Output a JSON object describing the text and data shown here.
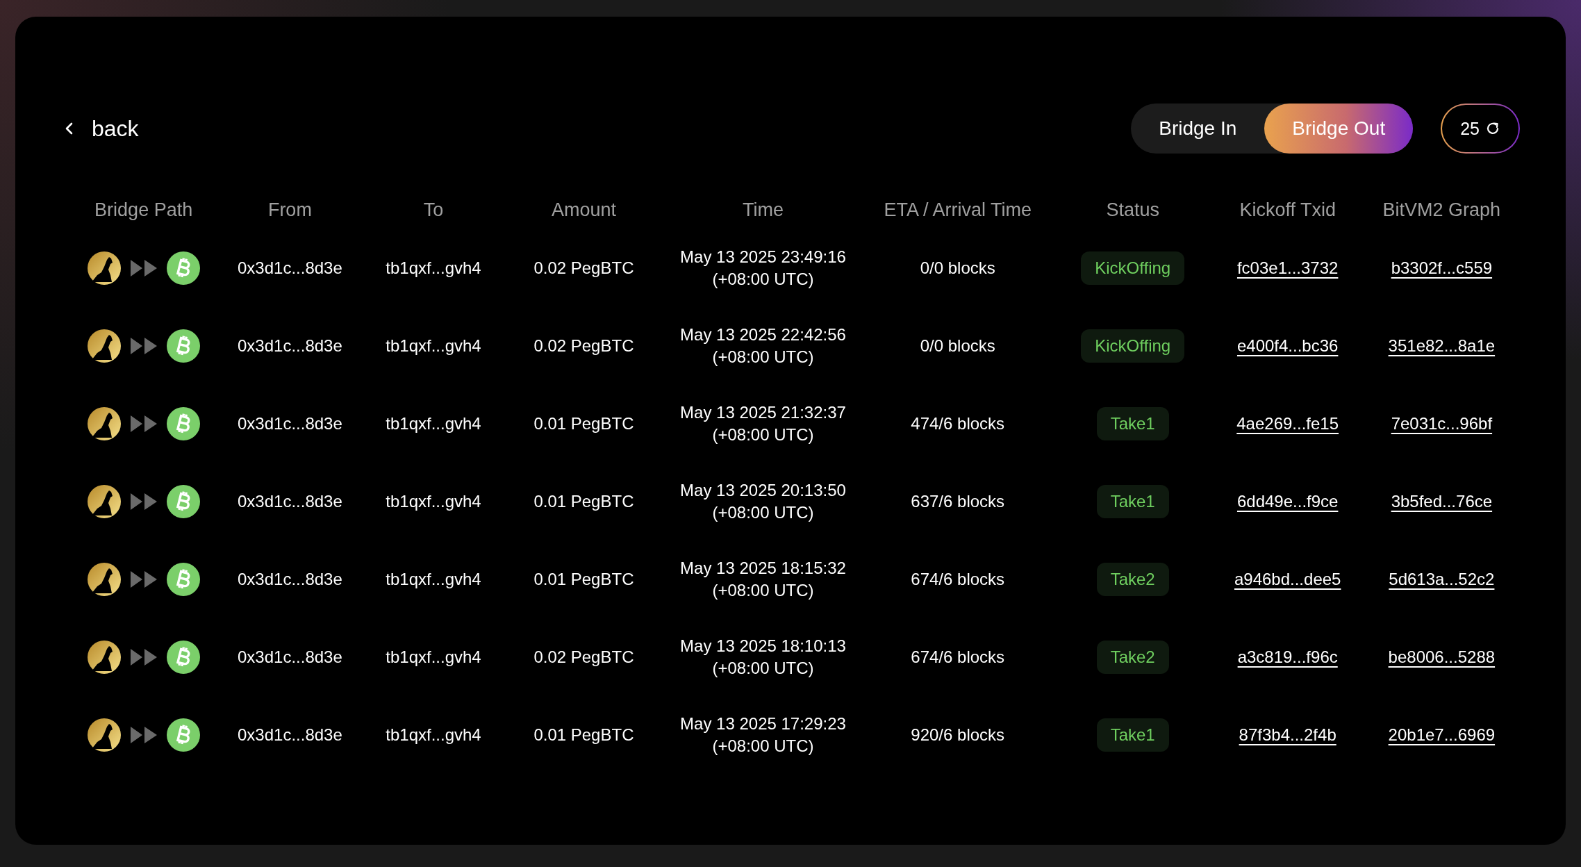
{
  "back": {
    "label": "back"
  },
  "tabs": [
    {
      "label": "Bridge In",
      "selected": false
    },
    {
      "label": "Bridge Out",
      "selected": true
    }
  ],
  "refresh": {
    "count": "25"
  },
  "table": {
    "columns": [
      "Bridge Path",
      "From",
      "To",
      "Amount",
      "Time",
      "ETA / Arrival Time",
      "Status",
      "Kickoff Txid",
      "BitVM2 Graph"
    ],
    "rows": [
      {
        "from": "0x3d1c...8d3e",
        "to": "tb1qxf...gvh4",
        "amount": "0.02 PegBTC",
        "time": "May 13 2025 23:49:16",
        "tz": "(+08:00 UTC)",
        "eta": "0/0 blocks",
        "status": "KickOffing",
        "kickoff": "fc03e1...3732",
        "graph": "b3302f...c559"
      },
      {
        "from": "0x3d1c...8d3e",
        "to": "tb1qxf...gvh4",
        "amount": "0.02 PegBTC",
        "time": "May 13 2025 22:42:56",
        "tz": "(+08:00 UTC)",
        "eta": "0/0 blocks",
        "status": "KickOffing",
        "kickoff": "e400f4...bc36",
        "graph": "351e82...8a1e"
      },
      {
        "from": "0x3d1c...8d3e",
        "to": "tb1qxf...gvh4",
        "amount": "0.01 PegBTC",
        "time": "May 13 2025 21:32:37",
        "tz": "(+08:00 UTC)",
        "eta": "474/6 blocks",
        "status": "Take1",
        "kickoff": "4ae269...fe15",
        "graph": "7e031c...96bf"
      },
      {
        "from": "0x3d1c...8d3e",
        "to": "tb1qxf...gvh4",
        "amount": "0.01 PegBTC",
        "time": "May 13 2025 20:13:50",
        "tz": "(+08:00 UTC)",
        "eta": "637/6 blocks",
        "status": "Take1",
        "kickoff": "6dd49e...f9ce",
        "graph": "3b5fed...76ce"
      },
      {
        "from": "0x3d1c...8d3e",
        "to": "tb1qxf...gvh4",
        "amount": "0.01 PegBTC",
        "time": "May 13 2025 18:15:32",
        "tz": "(+08:00 UTC)",
        "eta": "674/6 blocks",
        "status": "Take2",
        "kickoff": "a946bd...dee5",
        "graph": "5d613a...52c2"
      },
      {
        "from": "0x3d1c...8d3e",
        "to": "tb1qxf...gvh4",
        "amount": "0.02 PegBTC",
        "time": "May 13 2025 18:10:13",
        "tz": "(+08:00 UTC)",
        "eta": "674/6 blocks",
        "status": "Take2",
        "kickoff": "a3c819...f96c",
        "graph": "be8006...5288"
      },
      {
        "from": "0x3d1c...8d3e",
        "to": "tb1qxf...gvh4",
        "amount": "0.01 PegBTC",
        "time": "May 13 2025 17:29:23",
        "tz": "(+08:00 UTC)",
        "eta": "920/6 blocks",
        "status": "Take1",
        "kickoff": "87f3b4...2f4b",
        "graph": "20b1e7...6969"
      }
    ]
  }
}
